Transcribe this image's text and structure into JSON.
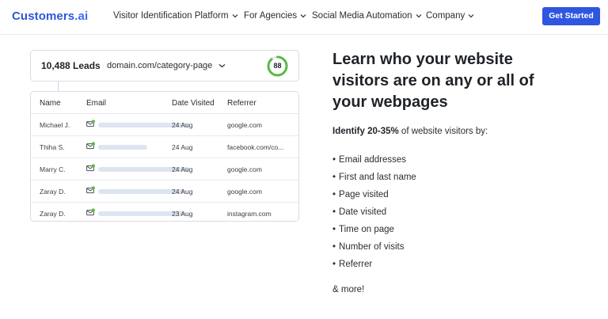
{
  "nav": {
    "logo_main": "Customers",
    "logo_suffix": ".ai",
    "items": [
      {
        "label": "Visitor Identification Platform"
      },
      {
        "label": "For Agencies"
      },
      {
        "label": "Social Media Automation"
      },
      {
        "label": "Company"
      }
    ],
    "cta_label": "Get Started",
    "accent_color": "#2f56e0"
  },
  "widget": {
    "leads_count": "10,488 Leads",
    "domain": "domain.com/category-page",
    "score": "88",
    "score_color": "#5ab946",
    "columns": [
      "Name",
      "Email",
      "Date Visited",
      "Referrer"
    ],
    "rows": [
      {
        "name": "Michael J.",
        "date": "24 Aug",
        "referrer": "google.com"
      },
      {
        "name": "Thiha S.",
        "date": "24 Aug",
        "referrer": "facebook.com/co..."
      },
      {
        "name": "Marry C.",
        "date": "24 Aug",
        "referrer": "google.com"
      },
      {
        "name": "Zaray D.",
        "date": "24 Aug",
        "referrer": "google.com"
      },
      {
        "name": "Zaray D.",
        "date": "23 Aug",
        "referrer": "instagram.com"
      }
    ]
  },
  "content": {
    "headline": "Learn who your website visitors are on any or all of your webpages",
    "intro_bold": "Identify 20-35%",
    "intro_rest": " of website visitors by:",
    "bullets": [
      "Email addresses",
      "First and last name",
      "Page visited",
      "Date visited",
      "Time on page",
      "Number of visits",
      "Referrer"
    ],
    "more": "& more!"
  }
}
